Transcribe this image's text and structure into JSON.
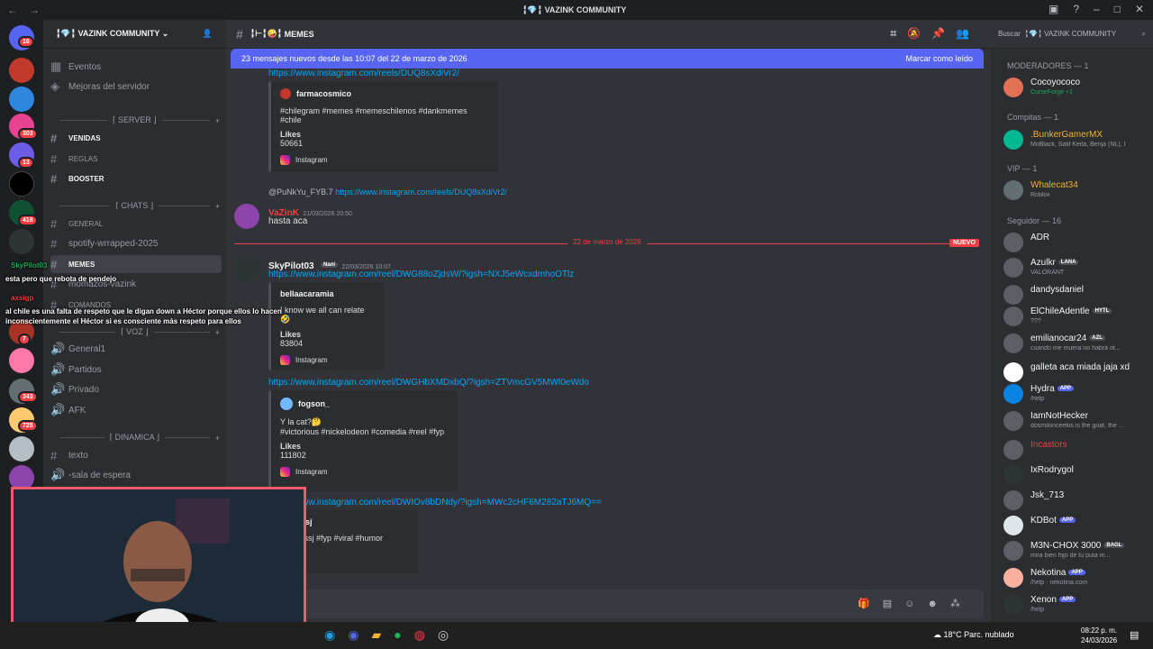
{
  "window": {
    "title": "VAZINK COMMUNITY",
    "title_prefix": "╏💎╏"
  },
  "servers": {
    "badges": [
      "16",
      "303",
      "13",
      "418",
      "7",
      "343",
      "725"
    ]
  },
  "guild": {
    "name": "VAZINK COMMUNITY",
    "name_prefix": "╏💎╏",
    "top_items": [
      "Eventos",
      "Mejoras del servidor"
    ],
    "categories": [
      {
        "label": "⌈ SERVER ⌋"
      },
      {
        "label": "⌈ CHATS ⌋"
      },
      {
        "label": "⌈ VOZ ⌋"
      },
      {
        "label": "⌈ DINAMICA ⌋"
      }
    ],
    "channels": {
      "venidas": "VENIDAS",
      "reglas": "REGLAS",
      "booster": "BOOSTER",
      "general": "GENERAL",
      "spotify": "spotify-wrrapped-2025",
      "memes": "MEMES",
      "momazos": "momazos-vazink",
      "comandos": "COMANDOS",
      "general1": "General1",
      "partidos": "Partidos",
      "privado": "Privado",
      "afk": "AFK",
      "texto": "texto",
      "sala": "-sala de espera"
    }
  },
  "header": {
    "channel": "MEMES",
    "channel_prefix": "╏⊢╏🤪╏"
  },
  "new_messages_bar": {
    "text": "23 mensajes nuevos desde las 10:07 del 22 de marzo de 2026",
    "action": "Marcar como leído"
  },
  "messages": {
    "link1": "https://www.instagram.com/reels/DUQ8sXdiVr2/",
    "embed1": {
      "author": "farmacosmico",
      "text": "#chilegram #memes #memeschilenos #dankmemes #chile",
      "likes_label": "Likes",
      "likes": "50661",
      "footer": "Instagram"
    },
    "reply": {
      "user": "@PuNkYu_FYB.7",
      "link": "https://www.instagram.com/reels/DUQ8sXdiVr2/"
    },
    "msg2": {
      "user": "VaZinK",
      "time": "21/03/2026 20:50",
      "text": "hasta aca"
    },
    "divider": {
      "date": "22 de marzo de 2026",
      "label": "NUEVO"
    },
    "msg3": {
      "user": "SkyPilot03",
      "tag": "Nani",
      "time": "22/03/2026 10:07",
      "link": "https://www.instagram.com/reel/DWG88oZjdsW/?igsh=NXJ5eWcxdmhoOTlz"
    },
    "embed2": {
      "author": "bellaacaramia",
      "text": "I know we all can relate 🤣",
      "likes_label": "Likes",
      "likes": "83804",
      "footer": "Instagram"
    },
    "link3": "https://www.instagram.com/reel/DWGHbXMDxbQ/?igsh=ZTVmcGV5MWl0eWdo",
    "embed3": {
      "author": "fogson_",
      "text1": "Y la cat?🤔",
      "text2": "#victorious #nickelodeon #comedia #reel #fyp",
      "likes_label": "Likes",
      "likes": "111802",
      "footer": "Instagram"
    },
    "link4": "https://www.instagram.com/reel/DWIOv8bDNdy/?igsh=MWc2cHF6M282aTJ6MQ==",
    "embed4": {
      "author": "cruzzssj",
      "text": "#cruzzssj #fyp #viral #humor"
    }
  },
  "search": {
    "placeholder": "Buscar",
    "scope": "╏💎╏ VAZINK COMMUNITY"
  },
  "members": {
    "groups": [
      {
        "label": "MODERADORES — 1"
      },
      {
        "label": "Compitas — 1"
      },
      {
        "label": "VIP — 1"
      },
      {
        "label": "Seguidor — 16"
      }
    ],
    "list": [
      {
        "name": "Cocoyococo",
        "status": "CurseForge +1",
        "color": "#f2f3f5"
      },
      {
        "name": ".BunkerGamerMX",
        "status": "MoBlack, Salif Keita, Benja (NL), I",
        "color": "#f0b232"
      },
      {
        "name": "Whalecat34",
        "status": "Roblox",
        "color": "#f0b232"
      },
      {
        "name": "ADR",
        "status": "",
        "color": "#f2f3f5"
      },
      {
        "name": "Azulkr",
        "tag": "LANA",
        "status": "VALORANT",
        "color": "#f2f3f5"
      },
      {
        "name": "dandysdaniel",
        "status": "",
        "color": "#f2f3f5"
      },
      {
        "name": "ElChileAdentle",
        "tag": "HYTL",
        "status": "???",
        "color": "#f2f3f5"
      },
      {
        "name": "emilianocar24",
        "tag": "AZL",
        "status": "cuando me muera no habrá ot...",
        "color": "#f2f3f5"
      },
      {
        "name": "galleta aca miada jaja xd",
        "status": "",
        "color": "#f2f3f5"
      },
      {
        "name": "Hydra",
        "tag": "APP",
        "status": "/help",
        "color": "#f2f3f5"
      },
      {
        "name": "IamNotHecker",
        "status": "dosmilonceekis is the goat, the ...",
        "color": "#f2f3f5"
      },
      {
        "name": "Incastors",
        "status": "",
        "color": "#f23f43"
      },
      {
        "name": "IxRodrygol",
        "status": "",
        "color": "#f2f3f5"
      },
      {
        "name": "Jsk_713",
        "status": "",
        "color": "#f2f3f5"
      },
      {
        "name": "KDBot",
        "tag": "APP",
        "status": "",
        "color": "#f2f3f5"
      },
      {
        "name": "M3N-CHOX 3000",
        "tag": "BAGL",
        "status": "mira bien hijo de tu puta m...",
        "color": "#f2f3f5"
      },
      {
        "name": "Nekotina",
        "tag": "APP",
        "status": "/help · nekotina.com",
        "color": "#f2f3f5"
      },
      {
        "name": "Xenon",
        "tag": "APP",
        "status": "/help",
        "color": "#f2f3f5"
      }
    ]
  },
  "overlay": {
    "user1": "SkyPilot03",
    "msg1": "esta pero que rebota de pendejo",
    "user2": "axsigp",
    "msg2": "al chile es una falta de respeto que le digan down a Héctor porque ellos lo hacen inconscientemente el Héctor si es consciente más respeto para ellos"
  },
  "taskbar": {
    "weather": "18°C",
    "weather_desc": "Parc. nublado",
    "time": "08:22 p. m.",
    "date": "24/03/2026"
  },
  "colors": {
    "accent": "#5865f2",
    "link": "#00a8fc",
    "danger": "#f23f43",
    "webcam_border": "#f05a6a"
  }
}
